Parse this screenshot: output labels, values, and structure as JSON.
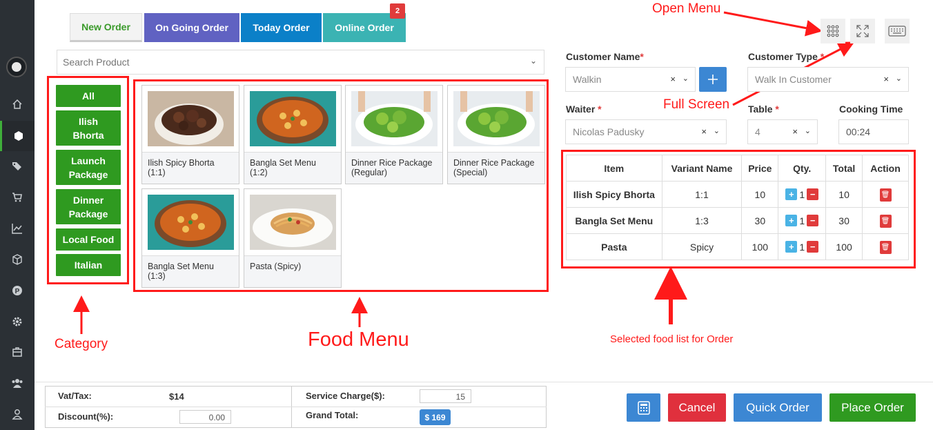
{
  "tabs": {
    "new_order": "New Order",
    "on_going_order": "On Going Order",
    "today_order": "Today Order",
    "online_order": "Online Order",
    "online_badge": "2"
  },
  "search": {
    "placeholder": "Search Product"
  },
  "categories": [
    "All",
    "Ilish Bhorta",
    "Launch Package",
    "Dinner Package",
    "Local Food",
    "Italian"
  ],
  "products": [
    {
      "name": "Ilish Spicy Bhorta (1:1)",
      "image": "meat-dish"
    },
    {
      "name": "Bangla Set Menu (1:2)",
      "image": "curry-dish"
    },
    {
      "name": "Dinner Rice Package (Regular)",
      "image": "salad-dish"
    },
    {
      "name": "Dinner Rice Package (Special)",
      "image": "salad-dish"
    },
    {
      "name": "Bangla Set Menu (1:3)",
      "image": "curry-dish"
    },
    {
      "name": "Pasta (Spicy)",
      "image": "pasta-dish"
    }
  ],
  "annotations": {
    "open_menu": "Open Menu",
    "full_screen": "Full Screen",
    "category": "Category",
    "food_menu": "Food Menu",
    "selected_food": "Selected food list for Order"
  },
  "form": {
    "customer_name_label": "Customer Name",
    "customer_name_value": "Walkin",
    "customer_type_label": "Customer Type",
    "customer_type_value": "Walk In Customer",
    "waiter_label": "Waiter",
    "waiter_value": "Nicolas Padusky",
    "table_label": "Table",
    "table_value": "4",
    "cooking_time_label": "Cooking Time",
    "cooking_time_value": "00:24",
    "required_mark": "*",
    "clear_mark": "×"
  },
  "order_table": {
    "headers": [
      "Item",
      "Variant Name",
      "Price",
      "Qty.",
      "Total",
      "Action"
    ],
    "rows": [
      {
        "item": "Ilish Spicy Bhorta",
        "variant": "1:1",
        "price": "10",
        "qty": "1",
        "total": "10"
      },
      {
        "item": "Bangla Set Menu",
        "variant": "1:3",
        "price": "30",
        "qty": "1",
        "total": "30"
      },
      {
        "item": "Pasta",
        "variant": "Spicy",
        "price": "100",
        "qty": "1",
        "total": "100"
      }
    ]
  },
  "summary": {
    "vat_label": "Vat/Tax:",
    "vat_value": "$14",
    "service_label": "Service Charge($):",
    "service_value": "15",
    "discount_label": "Discount(%):",
    "discount_value": "0.00",
    "grand_label": "Grand Total:",
    "grand_value": "$ 169"
  },
  "buttons": {
    "cancel": "Cancel",
    "quick_order": "Quick Order",
    "place_order": "Place Order"
  },
  "colors": {
    "green": "#2f9a20",
    "red": "#e03b3b",
    "blue": "#3c87d3",
    "annotation": "#ff1a1a"
  }
}
